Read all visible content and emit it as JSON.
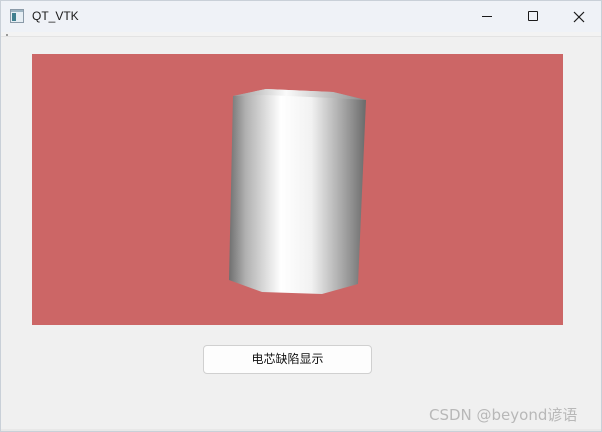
{
  "window": {
    "title": "QT_VTK",
    "controls": {
      "minimize": "minimize-icon",
      "maximize": "maximize-icon",
      "close": "close-icon"
    }
  },
  "viewport": {
    "background_color": "#cc6666",
    "object": "cylinder",
    "object_shading": [
      "#6f6f6f",
      "#ffffff",
      "#6f6f6f"
    ]
  },
  "actions": {
    "show_defect_label": "电芯缺陷显示"
  },
  "watermark": {
    "text": "CSDN @beyond谚语"
  }
}
